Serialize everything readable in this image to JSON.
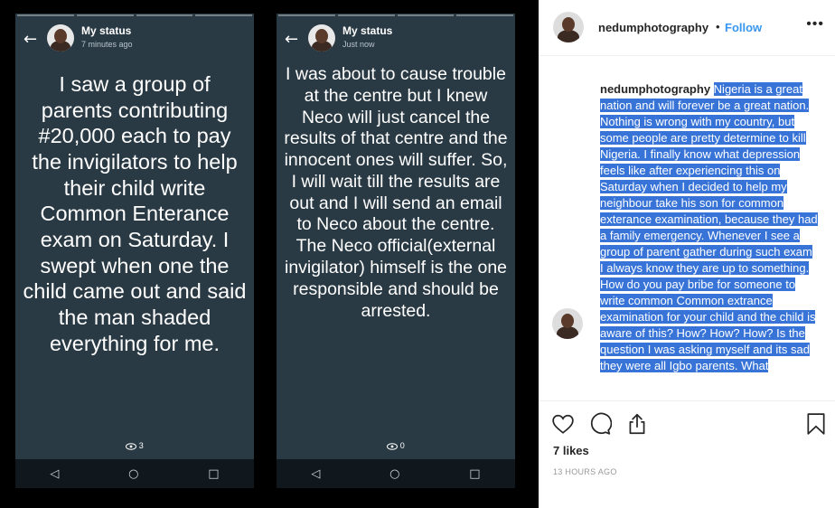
{
  "stories": [
    {
      "name": "My status",
      "time": "7 minutes ago",
      "message": "I saw a group of parents contributing #20,000 each to pay the invigilators to help their child write Common Enterance exam on Saturday. I swept when one the child came out and said the man shaded everything for me.",
      "views": "3",
      "nav": [
        "◁",
        "○",
        "□"
      ]
    },
    {
      "name": "My status",
      "time": "Just now",
      "message": "I was about to cause trouble at the centre but I knew Neco will just cancel the results of that centre and the innocent ones will suffer. So, I will wait till the results are out and I will send an email to Neco about the centre. The Neco official(external invigilator) himself is the one responsible and should be arrested.",
      "views": "0",
      "nav": [
        "◁",
        "○",
        "□"
      ]
    }
  ],
  "post": {
    "username": "nedumphotography",
    "separator": "•",
    "follow_label": "Follow",
    "more": "•••",
    "caption_user": "nedumphotography",
    "caption": "Nigeria is a great nation and will forever be a great nation. Nothing is wrong with my country, but some people are pretty determine to kill Nigeria. I finally know what depression feels like after experiencing this on Saturday when I decided to help my neighbour take his son for common exterance examination, because they had a family emergency. Whenever I see a group of parent gather during such exam I always know they are up to something. How do you pay bribe for someone to write common Common extrance examination for your child and the child is aware of this? How? How? How? Is the question I was asking myself and its sad they were all Igbo parents. What",
    "likes": "7 likes",
    "time": "13 HOURS AGO"
  },
  "icons": {
    "back": "arrow-left-icon",
    "views": "eye-icon",
    "like": "heart-icon",
    "comment": "comment-icon",
    "share": "share-icon",
    "save": "bookmark-icon"
  },
  "colors": {
    "story_bg": "#2a3a44",
    "selection": "#3874d8",
    "follow": "#3897f0"
  }
}
